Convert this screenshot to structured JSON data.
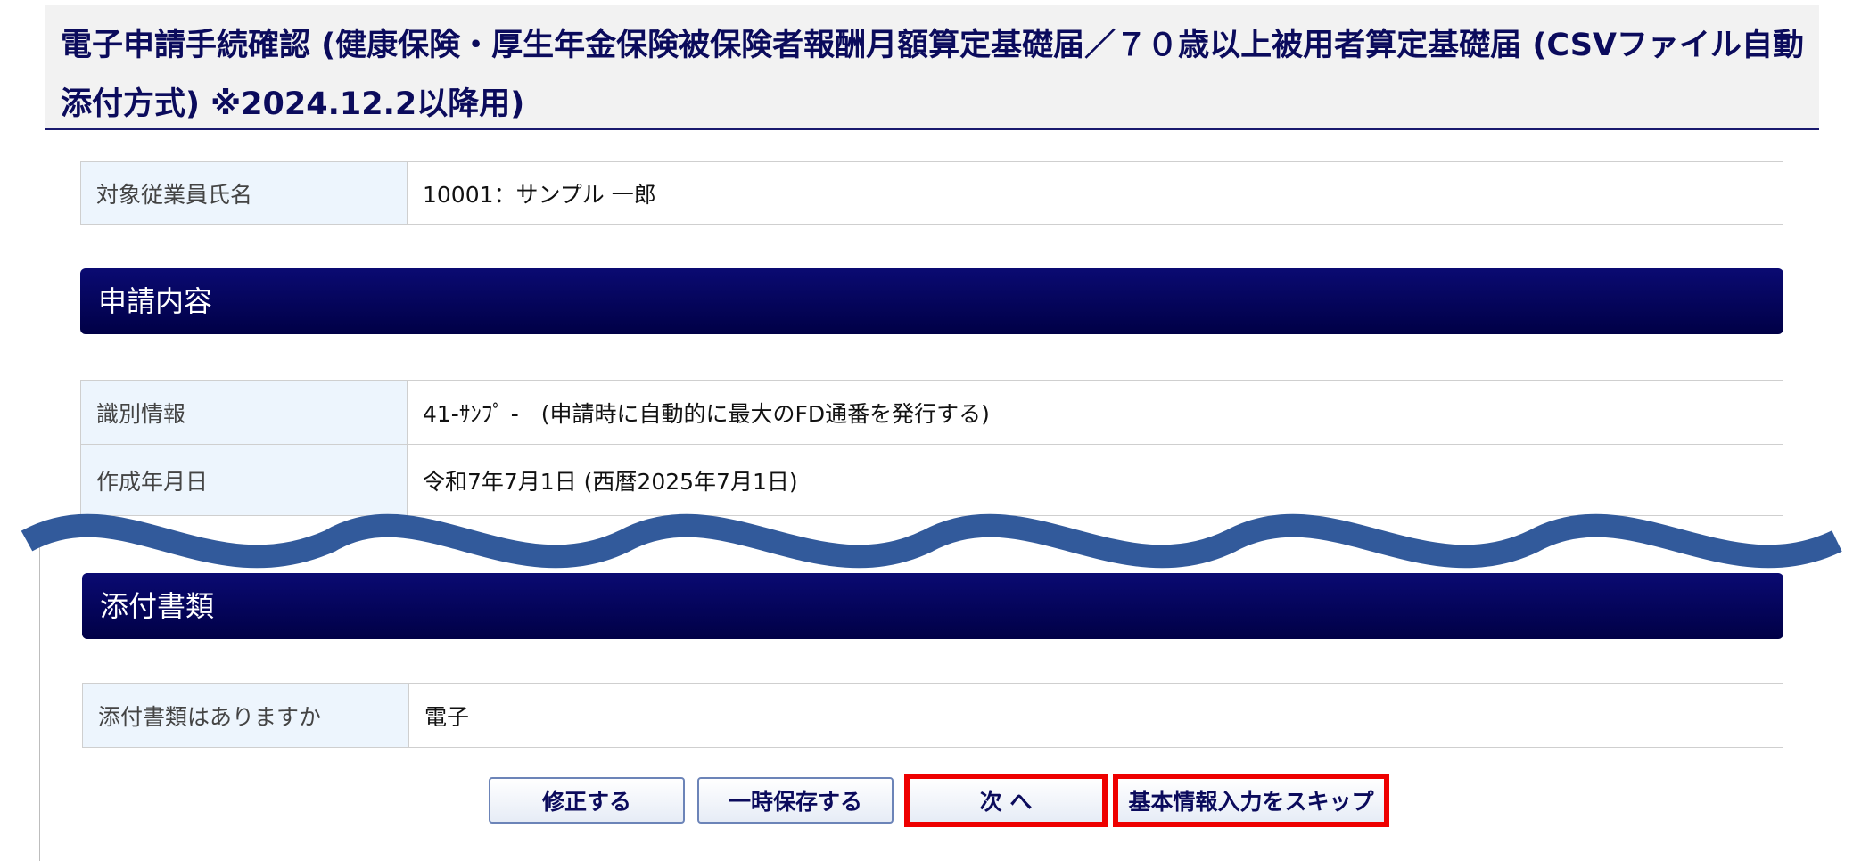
{
  "header": {
    "title": "電子申請手続確認 (健康保険・厚生年金保険被保険者報酬月額算定基礎届／７０歳以上被用者算定基礎届 (CSVファイル自動添付方式) ※2024.12.2以降用)"
  },
  "employee": {
    "label": "対象従業員氏名",
    "value": "10001：サンプル 一郎"
  },
  "application_section": {
    "heading": "申請内容",
    "rows": [
      {
        "label": "識別情報",
        "value": "41-ｻﾝﾌﾟ -　(申請時に自動的に最大のFD通番を発行する)"
      },
      {
        "label": "作成年月日",
        "value": "令和7年7月1日 (西暦2025年7月1日)"
      }
    ]
  },
  "attachment_section": {
    "heading": "添付書類",
    "rows": [
      {
        "label": "添付書類はありますか",
        "value": "電子"
      }
    ]
  },
  "buttons": {
    "edit": "修正する",
    "save_draft": "一時保存する",
    "next": "次 へ",
    "skip_basic_info": "基本情報入力をスキップ"
  },
  "colors": {
    "section_bar": "#000046",
    "label_cell": "#edf5fd",
    "highlight_border": "#ee0000",
    "wave": "#325a9b"
  }
}
